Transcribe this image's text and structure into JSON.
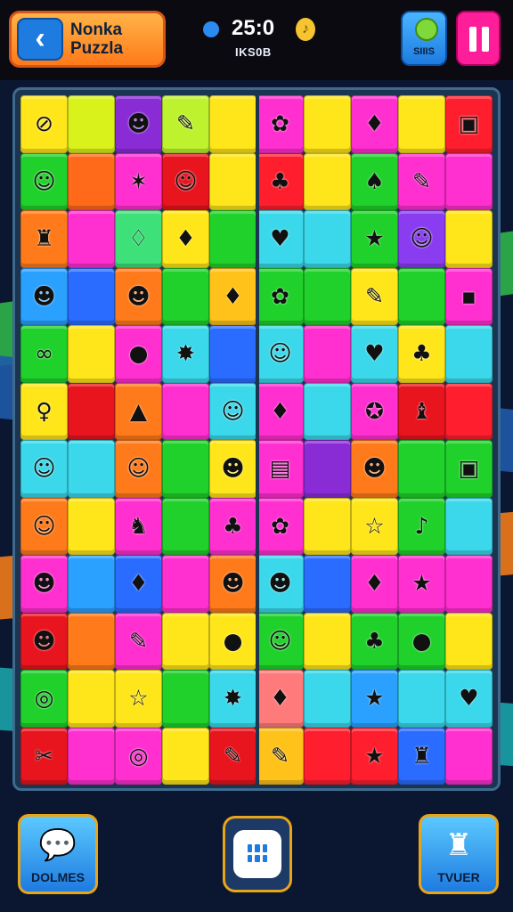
{
  "header": {
    "title": "Nonka Puzzla",
    "back_icon": "chevron-left-icon",
    "score": "25:0",
    "score_sub": "IKS0B",
    "coin_icon": "coin-icon",
    "sub_button_label": "SIIIS",
    "pause_icon": "pause-icon"
  },
  "board": {
    "rows": [
      [
        "#ffe61a",
        "#d9f21c",
        "#8a2cd6",
        "#bff22e",
        "#ffe61a",
        "#ff2fd0",
        "#ffe61a",
        "#ff2fd0",
        "#ffe61a",
        "#ff1e2e"
      ],
      [
        "#1fd12a",
        "#ff6a1a",
        "#ff2fd0",
        "#e8141e",
        "#ffe61a",
        "#ff1e2e",
        "#ffe61a",
        "#1fd12a",
        "#ff2fd0",
        "#ff2fd0"
      ],
      [
        "#ff7a1a",
        "#ff2fd0",
        "#3ee07a",
        "#ffe61a",
        "#1fd12a",
        "#3ad8ea",
        "#3ad8ea",
        "#1fd12a",
        "#8a3cf0",
        "#ffe61a"
      ],
      [
        "#2aa0ff",
        "#2a6cff",
        "#ff7a1a",
        "#1fd12a",
        "#ffc21a",
        "#1fd12a",
        "#1fd12a",
        "#ffe61a",
        "#1fd12a",
        "#ff2fd0"
      ],
      [
        "#1fd12a",
        "#ffe61a",
        "#ff2fd0",
        "#3ad8ea",
        "#2a6cff",
        "#3ad8ea",
        "#ff2fd0",
        "#3ad8ea",
        "#ffe61a",
        "#3ad8ea"
      ],
      [
        "#ffe61a",
        "#e8141e",
        "#ff7a1a",
        "#ff2fd0",
        "#3ad8ea",
        "#ff2fd0",
        "#3ad8ea",
        "#ff2fd0",
        "#e8141e",
        "#ff1e2e"
      ],
      [
        "#3ad8ea",
        "#3ad8ea",
        "#ff7a1a",
        "#1fd12a",
        "#ffe61a",
        "#ff2fd0",
        "#8a2cd6",
        "#ff7a1a",
        "#1fd12a",
        "#1fd12a"
      ],
      [
        "#ff7a1a",
        "#ffe61a",
        "#ff2fd0",
        "#1fd12a",
        "#ff2fd0",
        "#ff2fd0",
        "#ffe61a",
        "#ffe61a",
        "#1fd12a",
        "#3ad8ea"
      ],
      [
        "#ff2fd0",
        "#2aa0ff",
        "#2a6cff",
        "#ff2fd0",
        "#ff7a1a",
        "#3ad8ea",
        "#2a6cff",
        "#ff2fd0",
        "#ff2fd0",
        "#ff2fd0"
      ],
      [
        "#e8141e",
        "#ff7a1a",
        "#ff2fd0",
        "#ffe61a",
        "#ffe61a",
        "#1fd12a",
        "#ffe61a",
        "#1fd12a",
        "#1fd12a",
        "#ffe61a"
      ],
      [
        "#1fd12a",
        "#ffe61a",
        "#ffe61a",
        "#1fd12a",
        "#3ad8ea",
        "#ff7a7a",
        "#3ad8ea",
        "#2aa0ff",
        "#3ad8ea",
        "#3ad8ea"
      ],
      [
        "#e8141e",
        "#ff2fd0",
        "#ff2fd0",
        "#ffe61a",
        "#e8141e",
        "#ffc21a",
        "#ff1e2e",
        "#ff1e2e",
        "#2a6cff",
        "#ff2fd0"
      ]
    ],
    "icons": [
      [
        "⊘",
        "",
        "☻",
        "✎",
        "",
        "✿",
        "",
        "♦",
        "",
        "▣"
      ],
      [
        "☺",
        "",
        "✶",
        "☺",
        "",
        "♣",
        "",
        "♠",
        "✎",
        ""
      ],
      [
        "♜",
        "",
        "♢",
        "♦",
        "",
        "♥",
        "",
        "★",
        "☺",
        ""
      ],
      [
        "☻",
        "",
        "☻",
        "",
        "♦",
        "✿",
        "",
        "✎",
        "",
        "▪"
      ],
      [
        "∞",
        "",
        "●",
        "✸",
        "",
        "☺",
        "",
        "♥",
        "♣",
        ""
      ],
      [
        "♀",
        "",
        "▲",
        "",
        "☺",
        "♦",
        "",
        "✪",
        "♝",
        ""
      ],
      [
        "☺",
        "",
        "☺",
        "",
        "☻",
        "▤",
        "",
        "☻",
        "",
        "▣"
      ],
      [
        "☺",
        "",
        "♞",
        "",
        "♣",
        "✿",
        "",
        "☆",
        "♪",
        ""
      ],
      [
        "☻",
        "",
        "♦",
        "",
        "☻",
        "☻",
        "",
        "♦",
        "★",
        ""
      ],
      [
        "☻",
        "",
        "✎",
        "",
        "●",
        "☺",
        "",
        "♣",
        "●",
        ""
      ],
      [
        "◎",
        "",
        "☆",
        "",
        "✸",
        "♦",
        "",
        "★",
        "",
        "♥"
      ],
      [
        "✂",
        "",
        "◎",
        "",
        "✎",
        "✎",
        "",
        "★",
        "♜",
        ""
      ]
    ]
  },
  "bottom": {
    "left_label": "DOLMES",
    "left_icon": "chat-bubble-icon",
    "center_icon": "grid-menu-icon",
    "right_label": "TVUER",
    "right_icon": "castle-icon"
  },
  "colors": {
    "accent_orange": "#ff7a1a",
    "accent_blue": "#1e7be0",
    "accent_pink": "#ff1e9a",
    "board_bg": "#1b3550"
  }
}
